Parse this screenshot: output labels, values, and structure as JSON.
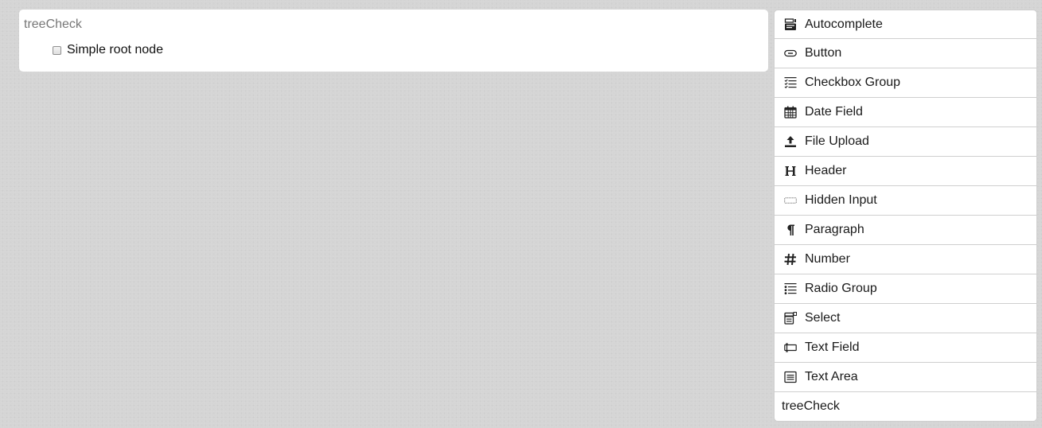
{
  "stage": {
    "field_label": "treeCheck",
    "tree": {
      "nodes": [
        {
          "label": "Simple root node",
          "checked": false
        }
      ]
    }
  },
  "palette": {
    "controls": [
      {
        "label": "Autocomplete",
        "icon": "autocomplete-icon"
      },
      {
        "label": "Button",
        "icon": "button-icon"
      },
      {
        "label": "Checkbox Group",
        "icon": "checkbox-group-icon"
      },
      {
        "label": "Date Field",
        "icon": "calendar-icon"
      },
      {
        "label": "File Upload",
        "icon": "upload-icon"
      },
      {
        "label": "Header",
        "icon": "header-icon"
      },
      {
        "label": "Hidden Input",
        "icon": "hidden-input-icon"
      },
      {
        "label": "Paragraph",
        "icon": "paragraph-icon"
      },
      {
        "label": "Number",
        "icon": "hash-icon"
      },
      {
        "label": "Radio Group",
        "icon": "radio-group-icon"
      },
      {
        "label": "Select",
        "icon": "select-icon"
      },
      {
        "label": "Text Field",
        "icon": "text-field-icon"
      },
      {
        "label": "Text Area",
        "icon": "text-area-icon"
      },
      {
        "label": "treeCheck",
        "icon": null
      }
    ]
  }
}
